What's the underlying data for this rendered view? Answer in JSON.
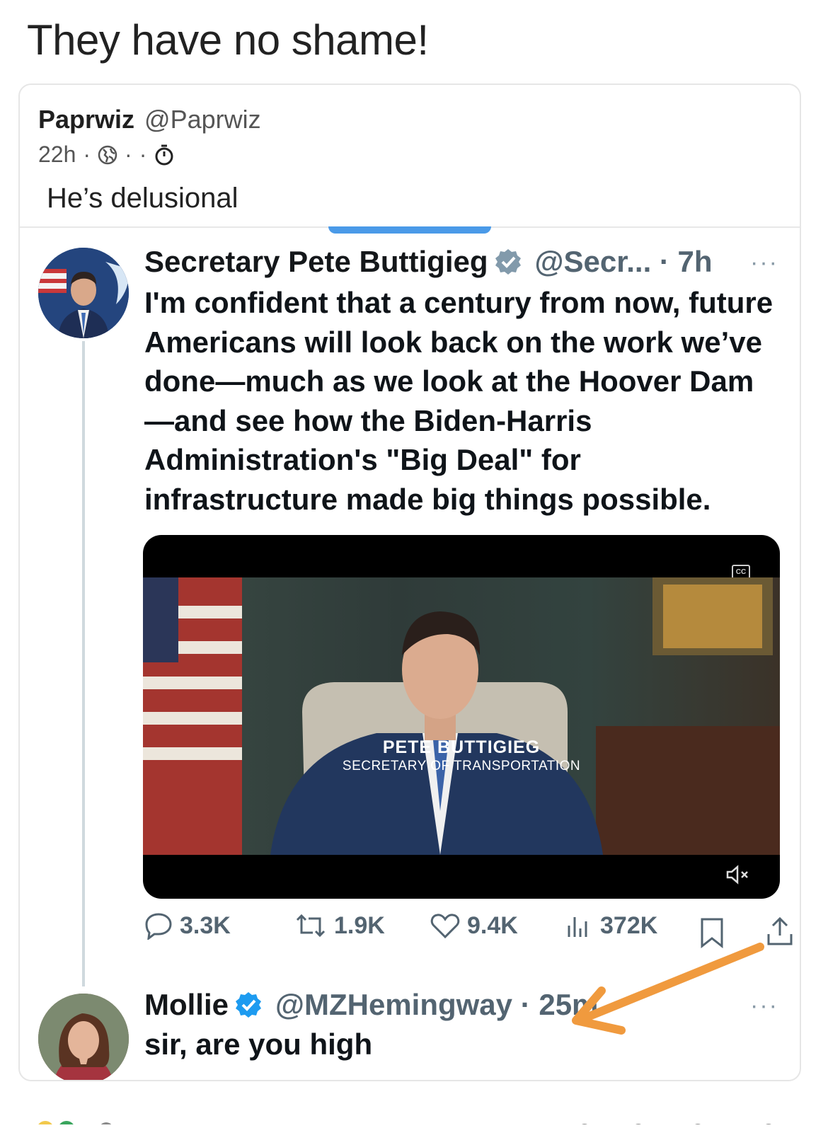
{
  "post": {
    "title": "They have no shame!"
  },
  "quote": {
    "author_name": "Paprwiz",
    "author_handle": "@Paprwiz",
    "time": "22h",
    "sep": "·",
    "text": "He’s delusional"
  },
  "tweet": {
    "name": "Secretary Pete Buttigieg",
    "handle_time": "@Secr... · 7h",
    "more": "···",
    "body": "I'm confident that a century from now, future Americans will look back on the work we’ve done—much as we look at the Hoover Dam—and see how the Biden-Harris Administration's \"Big Deal\" for infrastructure made big things possible.",
    "video": {
      "lower_third_name": "PETE BUTTIGIEG",
      "lower_third_title": "SECRETARY OF TRANSPORTATION",
      "cc_label": "CC"
    },
    "actions": {
      "replies": "3.3K",
      "reposts": "1.9K",
      "likes": "9.4K",
      "views": "372K"
    }
  },
  "reply": {
    "name": "Mollie",
    "handle_time": "@MZHemingway · 25m",
    "more": "···",
    "body": "sir, are you high"
  },
  "colors": {
    "verified_blue": "#1d9bf0",
    "verified_gray": "#829aab",
    "arrow_orange": "#f09a3e",
    "muted_text": "#536471"
  },
  "icons": [
    "globe-icon",
    "timer-icon",
    "verified-icon",
    "reply-icon",
    "repost-icon",
    "like-icon",
    "views-icon",
    "bookmark-icon",
    "share-icon",
    "captions-icon",
    "mute-icon",
    "arrow-annotation"
  ]
}
